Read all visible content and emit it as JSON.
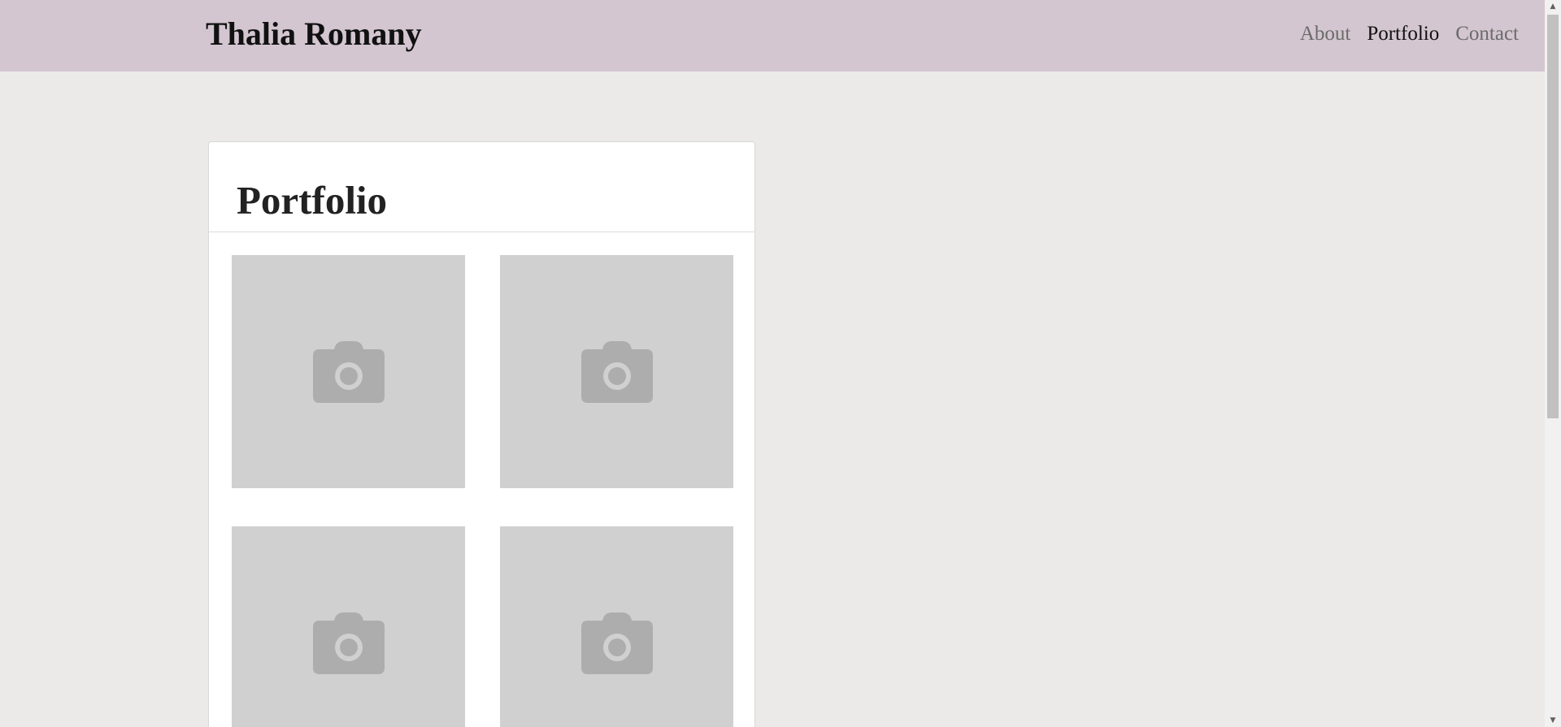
{
  "header": {
    "brand": "Thalia Romany",
    "nav": [
      {
        "label": "About",
        "active": false
      },
      {
        "label": "Portfolio",
        "active": true
      },
      {
        "label": "Contact",
        "active": false
      }
    ]
  },
  "main": {
    "title": "Portfolio",
    "thumbnails": [
      {
        "icon": "camera-icon"
      },
      {
        "icon": "camera-icon"
      },
      {
        "icon": "camera-icon"
      },
      {
        "icon": "camera-icon"
      }
    ]
  },
  "colors": {
    "header_bg": "#d3c6d0",
    "page_bg": "#ebeae8",
    "placeholder_bg": "#d0d0d0",
    "icon_color": "#adadad"
  }
}
